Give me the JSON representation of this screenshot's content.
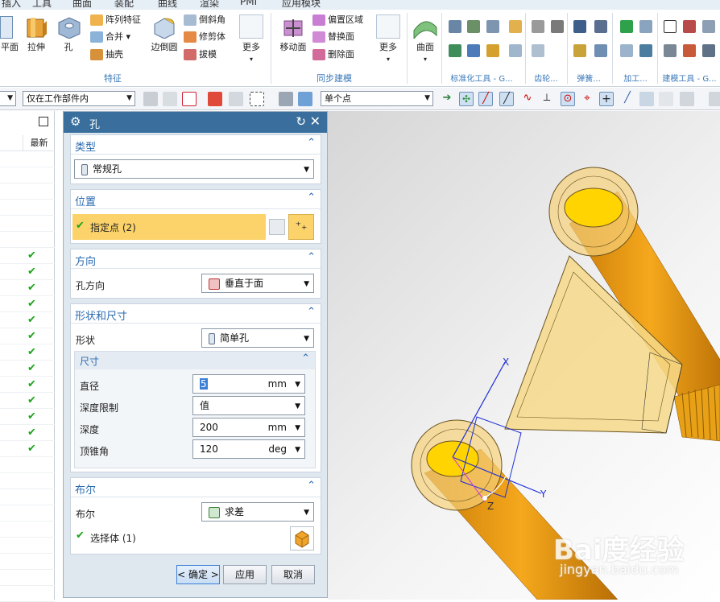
{
  "menubar": {
    "items": [
      "插入",
      "工具",
      "曲面",
      "装配",
      "曲线",
      "渲染",
      "PMI",
      "应用模块"
    ]
  },
  "ribbon": {
    "large_buttons": {
      "plane": "平面",
      "extrude": "拉伸",
      "hole": "孔",
      "edge_blend": "边倒圆",
      "more1": "更多",
      "move_face": "移动面",
      "more2": "更多",
      "surface": "曲面"
    },
    "small_buttons": {
      "pattern_feature": "阵列特征",
      "unite": "合并",
      "shell": "抽壳",
      "chamfer": "倒斜角",
      "trim_body": "修剪体",
      "draft": "拔模",
      "offset_region": "偏置区域",
      "replace_face": "替换面",
      "delete_face": "删除面"
    },
    "groups": {
      "feature": "特征",
      "sync_modeling": "同步建模",
      "std_tools": "标准化工具 - G...",
      "gear": "齿轮...",
      "spring": "弹簧...",
      "machining": "加工...",
      "build_tools": "建模工具 - G..."
    }
  },
  "toolbar2": {
    "filter_combo": "仅在工作部件内",
    "snap_combo": "单个点"
  },
  "navigator": {
    "column_header": "最新",
    "checked_rows": 13
  },
  "dialog": {
    "title": "孔",
    "type": {
      "header": "类型",
      "value": "常规孔"
    },
    "position": {
      "header": "位置",
      "specify_point": "指定点 (2)"
    },
    "direction": {
      "header": "方向",
      "label": "孔方向",
      "value": "垂直于面"
    },
    "shape": {
      "header": "形状和尺寸",
      "shape_label": "形状",
      "shape_value": "简单孔",
      "dims": {
        "header": "尺寸",
        "diameter": {
          "label": "直径",
          "value": "5",
          "unit": "mm"
        },
        "depth_limit": {
          "label": "深度限制",
          "value": "值"
        },
        "depth": {
          "label": "深度",
          "value": "200",
          "unit": "mm"
        },
        "tip_angle": {
          "label": "顶锥角",
          "value": "120",
          "unit": "deg"
        }
      }
    },
    "boolean": {
      "header": "布尔",
      "label": "布尔",
      "value": "求差",
      "select_body": "选择体 (1)"
    },
    "buttons": {
      "ok": "< 确定 >",
      "apply": "应用",
      "cancel": "取消"
    }
  },
  "viewport": {
    "axis_x": "X",
    "axis_y": "Y",
    "axis_z": "Z",
    "watermark_logo": "Bai度经验",
    "watermark_url": "jingyan.baidu.com"
  },
  "colors": {
    "title_bar": "#3a6f9d",
    "highlight": "#fbd36a",
    "group_header": "#2b6bb0",
    "accent_orange": "#e8a317",
    "check_green": "#1aa51a"
  }
}
